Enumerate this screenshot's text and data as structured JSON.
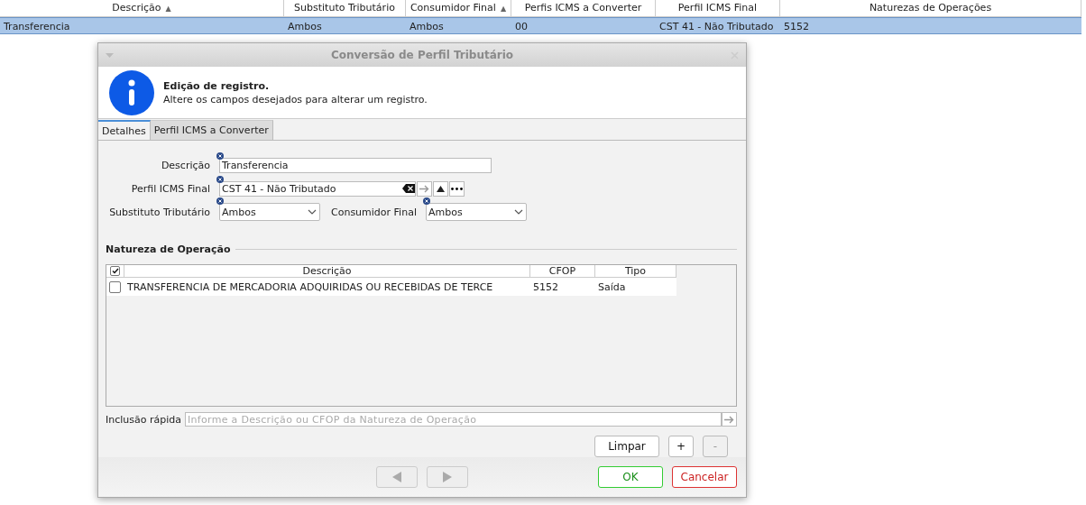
{
  "table": {
    "columns": [
      {
        "label": "Descrição",
        "sort_mark": "▲"
      },
      {
        "label": "Substituto Tributário"
      },
      {
        "label": "Consumidor Final",
        "sort_mark": "▲"
      },
      {
        "label": "Perfis ICMS a Converter"
      },
      {
        "label": "Perfil ICMS Final"
      },
      {
        "label": "Naturezas de Operações"
      }
    ],
    "rows": [
      {
        "selected": true,
        "cells": [
          "Transferencia",
          "Ambos",
          "Ambos",
          "00",
          "CST 41 - Não Tributado",
          "5152"
        ]
      }
    ]
  },
  "dialog": {
    "title": "Conversão de Perfil Tributário",
    "header_title": "Edição de registro.",
    "header_text": "Altere os campos desejados para alterar um registro.",
    "tabs": [
      {
        "label": "Detalhes",
        "selected": true
      },
      {
        "label": "Perfil ICMS a Converter",
        "selected": false
      }
    ],
    "fields": {
      "descricao": {
        "label": "Descrição",
        "value": "Transferencia"
      },
      "perfil": {
        "label": "Perfil ICMS Final",
        "value": "CST 41 - Não Tributado"
      },
      "substituto": {
        "label": "Substituto Tributário",
        "value": "Ambos"
      },
      "consumidor": {
        "label": "Consumidor Final",
        "value": "Ambos"
      }
    },
    "section_title": "Natureza de Operação",
    "grid": {
      "all_checked": true,
      "columns": [
        "Descrição",
        "CFOP",
        "Tipo"
      ],
      "rows": [
        {
          "checked": false,
          "cells": [
            "TRANSFERENCIA DE MERCADORIA ADQUIRIDAS OU RECEBIDAS DE TERCE",
            "5152",
            "Saída"
          ]
        }
      ]
    },
    "quick_add": {
      "label": "Inclusão rápida",
      "placeholder": "Informe a Descrição ou CFOP da Natureza de Operação"
    },
    "grid_buttons": [
      {
        "label": "Limpar",
        "disabled": false
      },
      {
        "label": "+",
        "disabled": false
      },
      {
        "label": "-",
        "disabled": true
      }
    ],
    "nav": [
      {
        "kind": "prev",
        "disabled": true
      },
      {
        "kind": "next",
        "disabled": true
      }
    ],
    "ok": "OK",
    "cancel": "Cancelar"
  }
}
